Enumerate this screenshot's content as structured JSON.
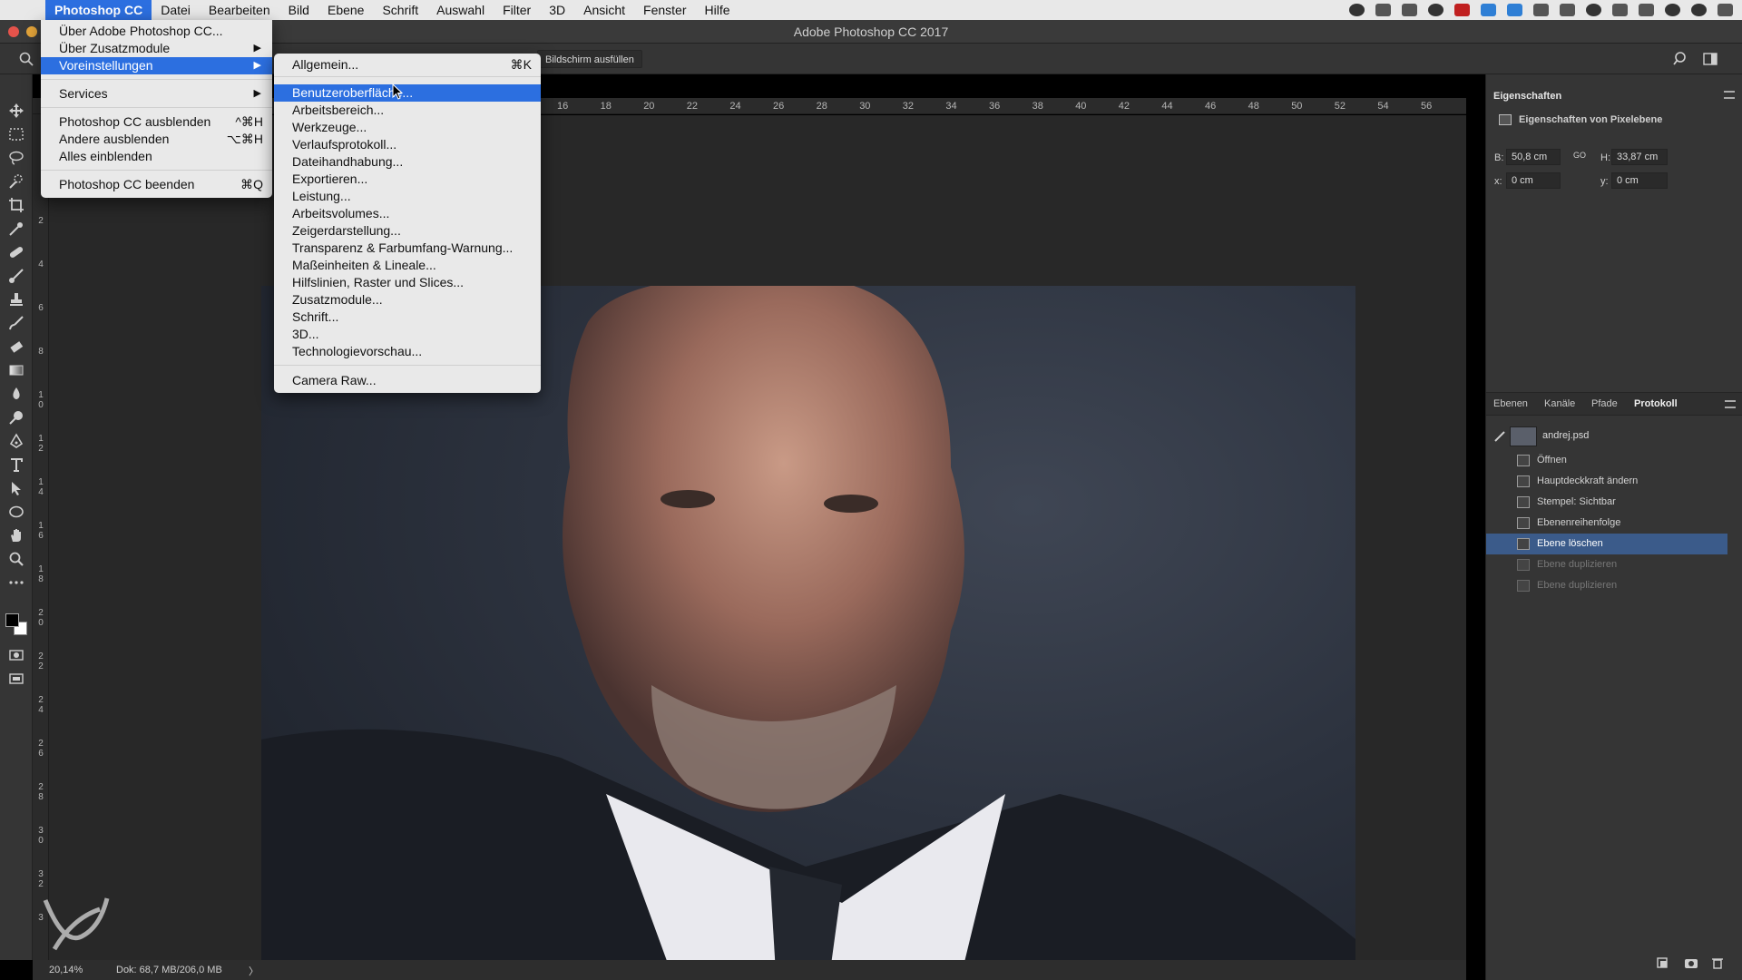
{
  "menubar": {
    "items": [
      "Photoshop CC",
      "Datei",
      "Bearbeiten",
      "Bild",
      "Ebene",
      "Schrift",
      "Auswahl",
      "Filter",
      "3D",
      "Ansicht",
      "Fenster",
      "Hilfe"
    ]
  },
  "window": {
    "title": "Adobe Photoshop CC 2017"
  },
  "options": {
    "fill_screen": "Bildschirm ausfüllen"
  },
  "app_menu": {
    "items": [
      {
        "label": "Über Adobe Photoshop CC...",
        "shortcut": ""
      },
      {
        "label": "Über Zusatzmodule",
        "shortcut": ""
      },
      {
        "label": "Voreinstellungen",
        "shortcut": ""
      },
      {
        "label": "Services",
        "shortcut": ""
      },
      {
        "label": "Photoshop CC ausblenden",
        "shortcut": "^⌘H"
      },
      {
        "label": "Andere ausblenden",
        "shortcut": "⌥⌘H"
      },
      {
        "label": "Alles einblenden",
        "shortcut": ""
      },
      {
        "label": "Photoshop CC beenden",
        "shortcut": "⌘Q"
      }
    ]
  },
  "prefs_menu": {
    "items": [
      {
        "label": "Allgemein...",
        "shortcut": "⌘K"
      },
      {
        "label": "Benutzeroberfläche..."
      },
      {
        "label": "Arbeitsbereich..."
      },
      {
        "label": "Werkzeuge..."
      },
      {
        "label": "Verlaufsprotokoll..."
      },
      {
        "label": "Dateihandhabung..."
      },
      {
        "label": "Exportieren..."
      },
      {
        "label": "Leistung..."
      },
      {
        "label": "Arbeitsvolumes..."
      },
      {
        "label": "Zeigerdarstellung..."
      },
      {
        "label": "Transparenz & Farbumfang-Warnung..."
      },
      {
        "label": "Maßeinheiten & Lineale..."
      },
      {
        "label": "Hilfslinien, Raster und Slices..."
      },
      {
        "label": "Zusatzmodule..."
      },
      {
        "label": "Schrift..."
      },
      {
        "label": "3D..."
      },
      {
        "label": "Technologievorschau..."
      },
      {
        "label": "Camera Raw..."
      }
    ]
  },
  "ruler": {
    "h_ticks": [
      "16",
      "18",
      "20",
      "22",
      "24",
      "26",
      "28",
      "30",
      "32",
      "34",
      "36",
      "38",
      "40",
      "42",
      "44",
      "46",
      "48",
      "50",
      "52",
      "54",
      "56"
    ],
    "v_ticks": [
      "2",
      "4",
      "6",
      "8",
      "10",
      "12",
      "14",
      "16",
      "18",
      "20",
      "22",
      "24",
      "26",
      "28",
      "30",
      "32",
      "3"
    ]
  },
  "properties": {
    "title": "Eigenschaften",
    "subtitle": "Eigenschaften von Pixelebene",
    "w_label": "B:",
    "w_value": "50,8 cm",
    "link_label": "GO",
    "h_label": "H:",
    "h_value": "33,87 cm",
    "x_label": "x:",
    "x_value": "0 cm",
    "y_label": "y:",
    "y_value": "0 cm"
  },
  "panel_tabs": [
    "Ebenen",
    "Kanäle",
    "Pfade",
    "Protokoll"
  ],
  "history": {
    "snapshot": "andrej.psd",
    "states": [
      {
        "label": "Öffnen"
      },
      {
        "label": "Hauptdeckkraft ändern"
      },
      {
        "label": "Stempel: Sichtbar"
      },
      {
        "label": "Ebenenreihenfolge"
      },
      {
        "label": "Ebene löschen"
      },
      {
        "label": "Ebene duplizieren"
      },
      {
        "label": "Ebene duplizieren"
      }
    ]
  },
  "statusbar": {
    "zoom": "20,14%",
    "doc": "Dok: 68,7 MB/206,0 MB",
    "arrow": "〉"
  },
  "colors": {
    "accent": "#2c6fe0",
    "selection": "#3b5b8a",
    "panel_bg": "#353535",
    "canvas_bg": "#282828"
  }
}
